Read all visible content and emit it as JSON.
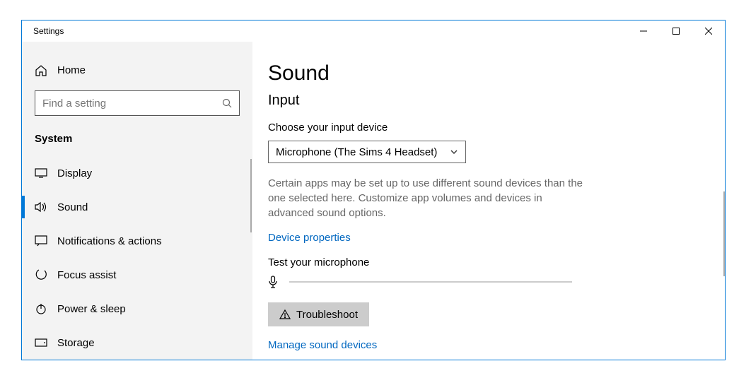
{
  "window": {
    "title": "Settings"
  },
  "sidebar": {
    "home_label": "Home",
    "search_placeholder": "Find a setting",
    "section_label": "System",
    "items": [
      {
        "label": "Display"
      },
      {
        "label": "Sound"
      },
      {
        "label": "Notifications & actions"
      },
      {
        "label": "Focus assist"
      },
      {
        "label": "Power & sleep"
      },
      {
        "label": "Storage"
      }
    ]
  },
  "main": {
    "page_title": "Sound",
    "section_title": "Input",
    "choose_label": "Choose your input device",
    "input_device": "Microphone (The Sims 4 Headset)",
    "description": "Certain apps may be set up to use different sound devices than the one selected here. Customize app volumes and devices in advanced sound options.",
    "device_properties_link": "Device properties",
    "test_label": "Test your microphone",
    "troubleshoot_label": "Troubleshoot",
    "manage_link": "Manage sound devices"
  }
}
